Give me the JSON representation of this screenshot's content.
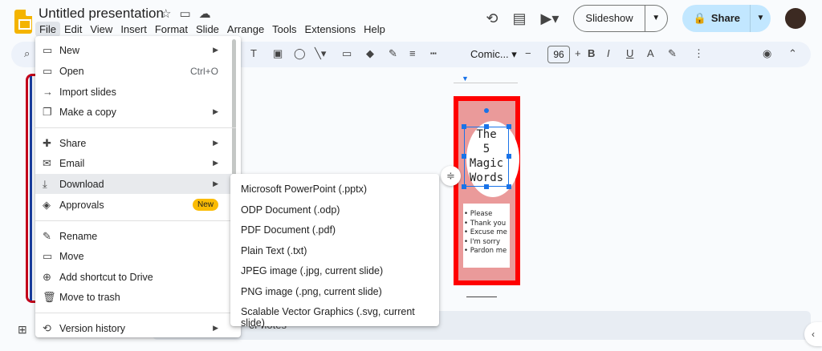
{
  "app": {
    "title": "Untitled presentation"
  },
  "menubar": [
    "File",
    "Edit",
    "View",
    "Insert",
    "Format",
    "Slide",
    "Arrange",
    "Tools",
    "Extensions",
    "Help"
  ],
  "header": {
    "slideshow_label": "Slideshow",
    "share_label": "Share"
  },
  "toolbar": {
    "font": "Comic...",
    "font_size": "96"
  },
  "file_menu": {
    "items": [
      {
        "label": "New",
        "icon": "new-slides-icon",
        "arrow": true
      },
      {
        "label": "Open",
        "icon": "folder-icon",
        "shortcut": "Ctrl+O"
      },
      {
        "label": "Import slides",
        "icon": "import-icon"
      },
      {
        "label": "Make a copy",
        "icon": "copy-icon",
        "arrow": true
      },
      {
        "label": "Share",
        "icon": "person-add-icon",
        "arrow": true
      },
      {
        "label": "Email",
        "icon": "mail-icon",
        "arrow": true
      },
      {
        "label": "Download",
        "icon": "download-icon",
        "arrow": true
      },
      {
        "label": "Approvals",
        "icon": "approvals-icon",
        "badge": "New"
      },
      {
        "label": "Rename",
        "icon": "rename-icon"
      },
      {
        "label": "Move",
        "icon": "move-folder-icon"
      },
      {
        "label": "Add shortcut to Drive",
        "icon": "drive-shortcut-icon"
      },
      {
        "label": "Move to trash",
        "icon": "trash-icon"
      },
      {
        "label": "Version history",
        "icon": "history-icon",
        "arrow": true
      }
    ]
  },
  "download_menu": {
    "items": [
      "Microsoft PowerPoint (.pptx)",
      "ODP Document (.odp)",
      "PDF Document (.pdf)",
      "Plain Text (.txt)",
      "JPEG image (.jpg, current slide)",
      "PNG image (.png, current slide)",
      "Scalable Vector Graphics (.svg, current slide)"
    ]
  },
  "slide": {
    "title_lines": [
      "The",
      "5",
      "Magic",
      "Words"
    ],
    "bullets": [
      "Please",
      "Thank you",
      "Excuse me",
      "I'm sorry",
      "Pardon me"
    ]
  },
  "notes": {
    "text": "er notes"
  },
  "colors": {
    "accent": "#1a73e8",
    "share_bg": "#c2e7ff",
    "slide_border": "#ff0000",
    "slide_fill": "#ea9a9a",
    "badge": "#fbbc04"
  }
}
